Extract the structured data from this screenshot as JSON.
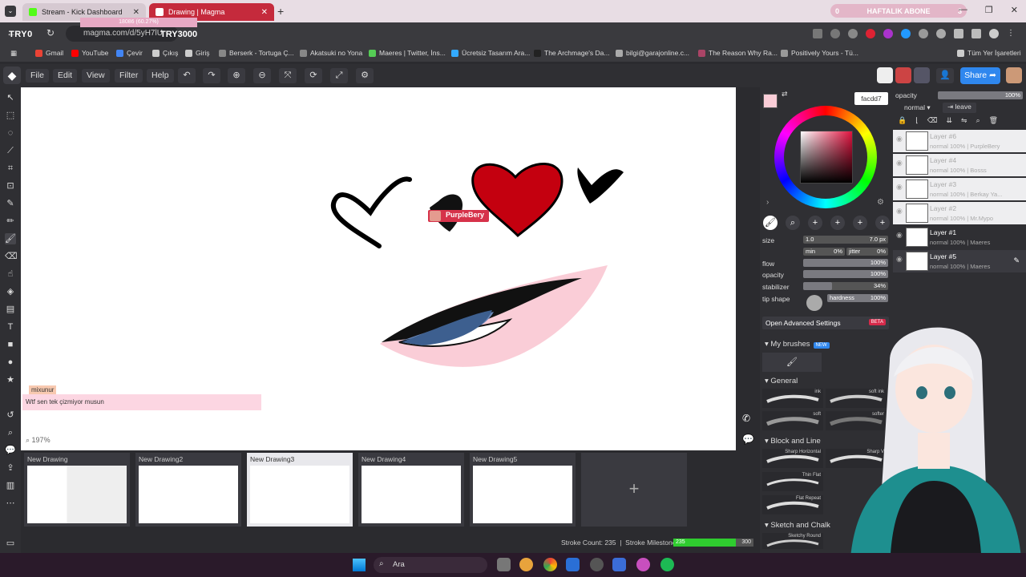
{
  "browser": {
    "tabs": [
      {
        "title": "Stream - Kick Dashboard",
        "active": false
      },
      {
        "title": "Drawing | Magma",
        "active": true
      }
    ],
    "stream_overlay": {
      "left": "TRY0",
      "right": "TRY3000",
      "progress": "18086 (60.27%)"
    },
    "banner": {
      "label": "HAFTALIK ABONE",
      "left_count": "0",
      "right_count": "3"
    },
    "url": "magma.com/d/5yH7lU",
    "bookmarks": [
      "Gmail",
      "YouTube",
      "Çevir",
      "Çıkış",
      "Giriş",
      "Berserk - Tortuga Ç...",
      "Akatsuki no Yona",
      "Maeres | Twitter, İns...",
      "Ücretsiz Tasarım Ara...",
      "The Archmage's Da...",
      "bilgi@garajonline.c...",
      "The Reason Why Ra...",
      "Positively Yours - Tü...",
      "Tüm Yer İşaretleri"
    ]
  },
  "app": {
    "menu": [
      "File",
      "Edit",
      "View",
      "Filter",
      "Help"
    ],
    "share_label": "Share",
    "zoom": "197%",
    "cursor_user": "PurpleBery",
    "chat": {
      "name": "mixunur",
      "message": "Wtf sen tek çizmiyor musun"
    },
    "drawings": [
      {
        "title": "New Drawing"
      },
      {
        "title": "New Drawing2"
      },
      {
        "title": "New Drawing3",
        "active": true
      },
      {
        "title": "New Drawing4"
      },
      {
        "title": "New Drawing5"
      }
    ],
    "stroke_count_label": "Stroke Count: 235",
    "stroke_milestone_label": "Stroke Milestone:",
    "milestone_value": "235",
    "milestone_max": "300",
    "milestone_fraction": 0.783
  },
  "brush_panel": {
    "hex": "facdd7",
    "primary_color": "#facdd7",
    "size_label": "size",
    "size_min": "1.0",
    "size_max": "7.0 px",
    "min_label": "min",
    "min_value": "0%",
    "jitter_label": "jitter",
    "jitter_value": "0%",
    "flow_label": "flow",
    "flow_value": "100%",
    "opacity_label": "opacity",
    "opacity_value": "100%",
    "stabilizer_label": "stabilizer",
    "stabilizer_value": "34%",
    "tip_label": "tip shape",
    "hardness_label": "hardness",
    "hardness_value": "100%",
    "advanced": "Open Advanced Settings",
    "beta": "BETA",
    "my_brushes": "My brushes",
    "new_badge": "NEW",
    "general": "General",
    "general_brushes": [
      "ink",
      "soft ink",
      "soft",
      "softer"
    ],
    "block_line": "Block and Line",
    "block_brushes": [
      "Sharp Horizontal",
      "Sharp V",
      "Thin Flat",
      "Flat Repeat"
    ],
    "sketch": "Sketch and Chalk",
    "sketch_brushes": [
      "Sketchy Round"
    ]
  },
  "layers_panel": {
    "opacity_label": "opacity",
    "opacity_value": "100%",
    "blend": "normal",
    "leave": "leave",
    "layers": [
      {
        "name": "Layer #6",
        "sub": "normal 100% | PurpleBery",
        "dim": true
      },
      {
        "name": "Layer #4",
        "sub": "normal 100% | Bosss",
        "dim": true
      },
      {
        "name": "Layer #3",
        "sub": "normal 100% | Berkay Ya...",
        "dim": true
      },
      {
        "name": "Layer #2",
        "sub": "normal 100% | Mr.Mypo",
        "dim": true
      },
      {
        "name": "Layer #1",
        "sub": "normal 100% | Maeres",
        "dim": false
      },
      {
        "name": "Layer #5",
        "sub": "normal 100% | Maeres",
        "dim": false,
        "selected": true
      }
    ]
  },
  "taskbar": {
    "search": "Ara"
  }
}
